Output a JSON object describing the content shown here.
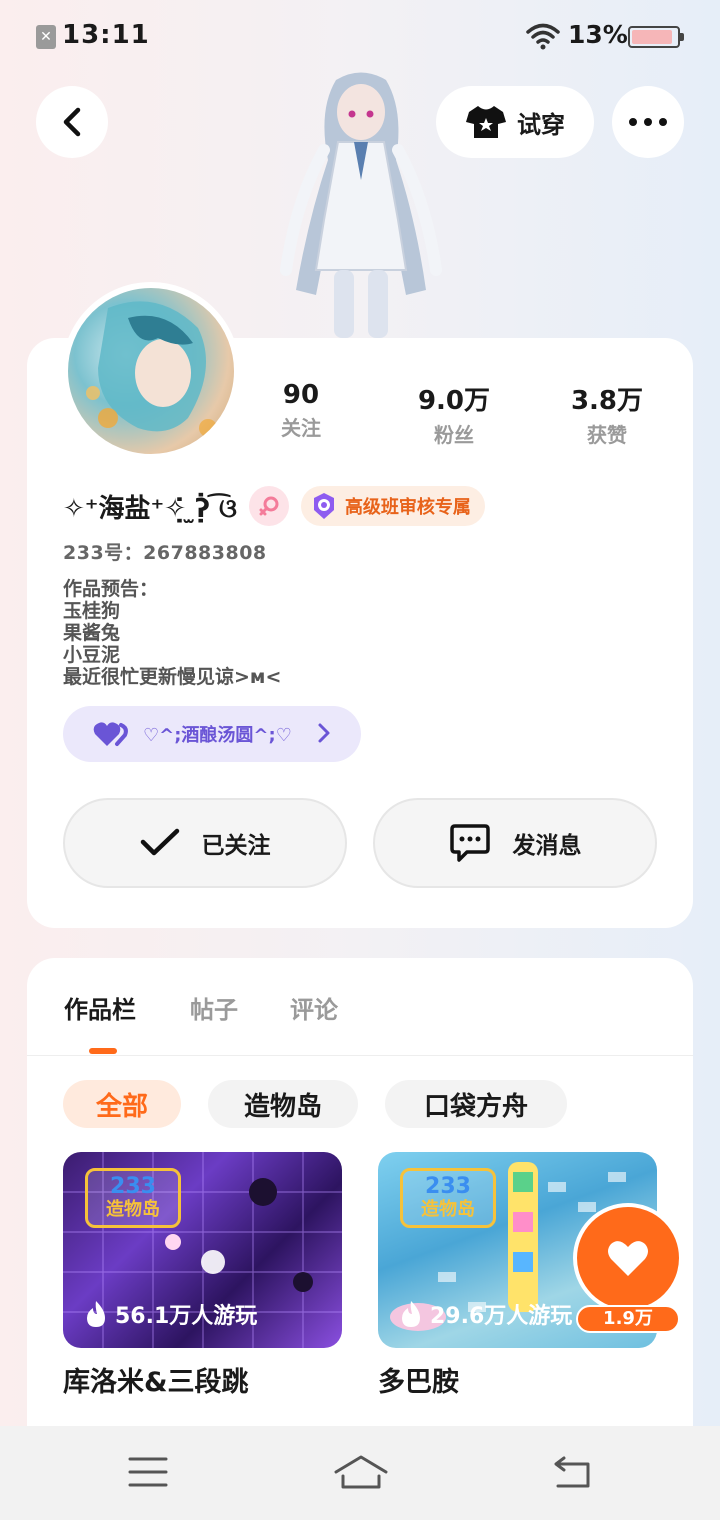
{
  "status_bar": {
    "time": "13:11",
    "battery_percent": "13%",
    "battery_level": 0.13
  },
  "header": {
    "tryon_label": "试穿"
  },
  "profile": {
    "stats": [
      {
        "value": "90",
        "label": "关注"
      },
      {
        "value": "9.0万",
        "label": "粉丝"
      },
      {
        "value": "3.8万",
        "label": "获赞"
      }
    ],
    "nickname": "✧⁺海盐⁺✧̣̇ ̫ʔ̣̇ ͡ଓ",
    "badge_label": "高级班审核专属",
    "uid": "233号：267883808",
    "bio_lines": [
      "作品预告：",
      "玉桂狗",
      "果酱兔",
      "小豆泥",
      "最近很忙更新慢见谅>ᴍ<"
    ],
    "group_chip": "♡^;酒酿汤圆^;♡",
    "follow_label": "已关注",
    "message_label": "发消息"
  },
  "tabs": [
    {
      "label": "作品栏",
      "active": true
    },
    {
      "label": "帖子",
      "active": false
    },
    {
      "label": "评论",
      "active": false
    }
  ],
  "filters": [
    {
      "label": "全部",
      "active": true
    },
    {
      "label": "造物岛",
      "active": false
    },
    {
      "label": "口袋方舟",
      "active": false
    }
  ],
  "games": [
    {
      "logo_top": "233",
      "logo_bottom": "造物岛",
      "plays": "56.1万人游玩",
      "title": "库洛米&三段跳"
    },
    {
      "logo_top": "233",
      "logo_bottom": "造物岛",
      "plays": "29.6万人游玩",
      "title": "多巴胺"
    }
  ],
  "like_fab": {
    "count": "1.9万"
  },
  "colors": {
    "accent": "#ff6a1a",
    "badge_purple": "#6a55d6",
    "gender_pink": "#f47c9a"
  }
}
